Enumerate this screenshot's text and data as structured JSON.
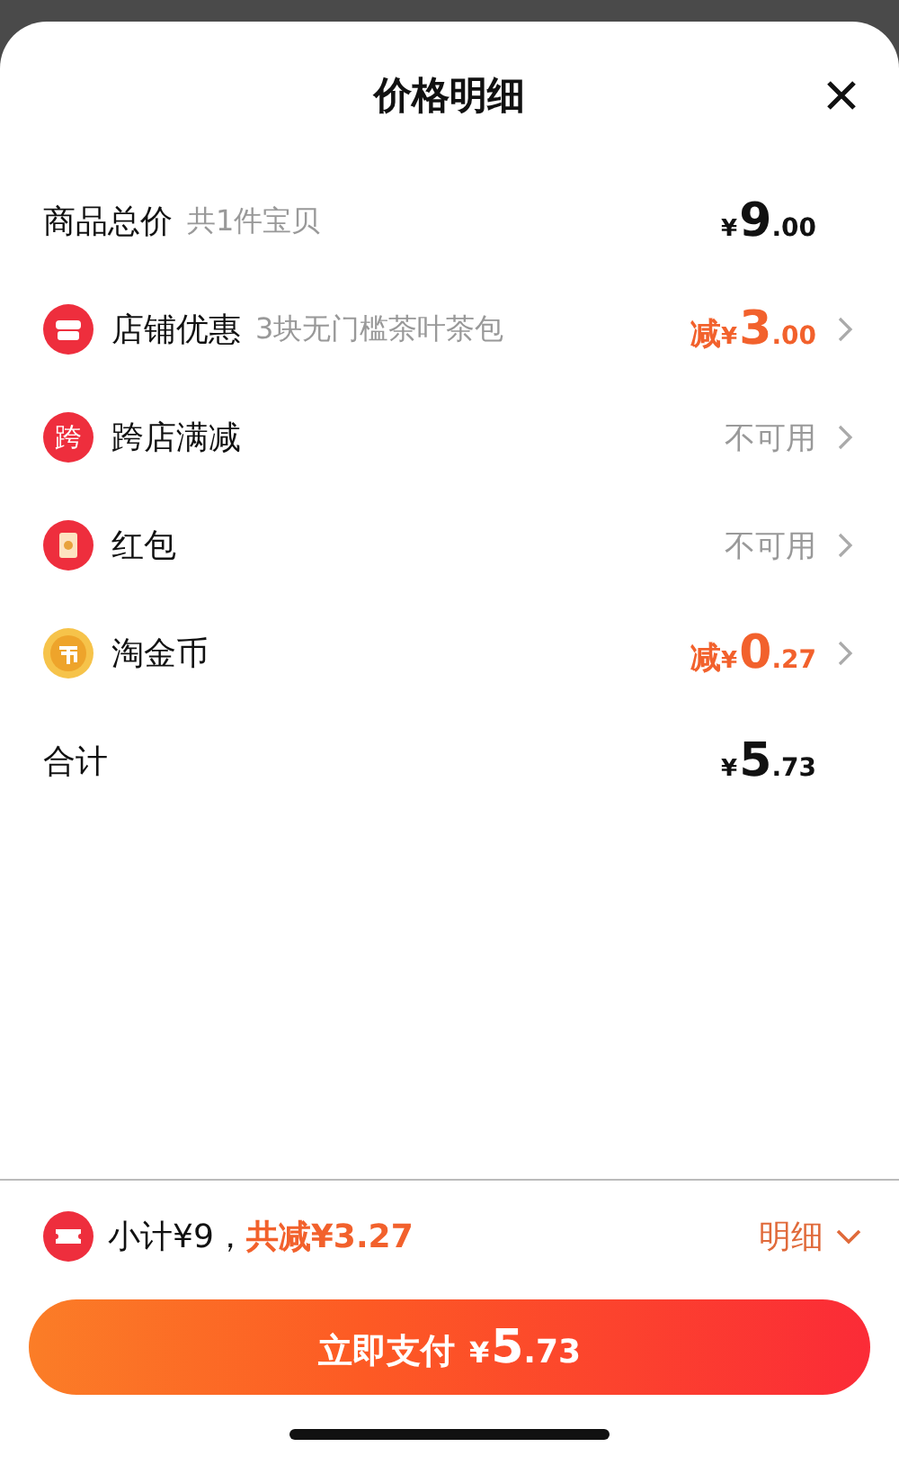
{
  "sheet": {
    "title": "价格明细"
  },
  "rows": [
    {
      "kind": "amount",
      "label": "商品总价",
      "note": "共1件宝贝",
      "value": {
        "discount": false,
        "currency": "¥",
        "integer": "9",
        "fraction": ".00"
      },
      "chevron": false
    },
    {
      "kind": "amount",
      "label": "店铺优惠",
      "note": "3块无门槛茶叶茶包",
      "value": {
        "discount": true,
        "prefix": "减",
        "currency": "¥",
        "integer": "3",
        "fraction": ".00"
      },
      "chevron": true
    },
    {
      "kind": "status",
      "icon_text": "跨",
      "label": "跨店满减",
      "status": "不可用",
      "chevron": true
    },
    {
      "kind": "status",
      "label": "红包",
      "status": "不可用",
      "chevron": true
    },
    {
      "kind": "amount",
      "label": "淘金币",
      "value": {
        "discount": true,
        "prefix": "减",
        "currency": "¥",
        "integer": "0",
        "fraction": ".27"
      },
      "chevron": true
    },
    {
      "kind": "amount",
      "label": "合计",
      "value": {
        "discount": false,
        "currency": "¥",
        "integer": "5",
        "fraction": ".73"
      },
      "chevron": false
    }
  ],
  "footer": {
    "subtotal": "小计¥9，",
    "saved": "共减¥3.27",
    "details_link": "明细",
    "expanded": false
  },
  "pay_button": {
    "label": "立即支付",
    "currency": "¥",
    "integer": "5",
    "fraction": ".73"
  }
}
